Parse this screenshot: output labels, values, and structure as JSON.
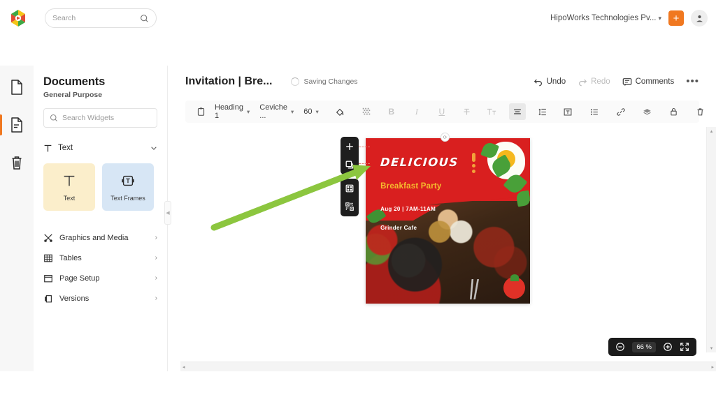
{
  "topbar": {
    "logo_icon": "app-logo-icon",
    "search": {
      "placeholder": "Search",
      "icon": "search-icon"
    },
    "org": {
      "name": "HipoWorks Technologies Pv...",
      "chevron": "chevron-down-icon"
    },
    "add_button": {
      "label": "+",
      "icon": "plus-icon",
      "color": "#f07820"
    },
    "account": {
      "icon": "user-avatar-icon"
    }
  },
  "rail": {
    "items": [
      {
        "name": "pages-icon",
        "active": false
      },
      {
        "name": "document-outline-icon",
        "active": true
      },
      {
        "name": "trash-icon",
        "active": false
      }
    ]
  },
  "panel": {
    "title": "Documents",
    "subtitle": "General Purpose",
    "search": {
      "placeholder": "Search Widgets",
      "icon": "search-icon"
    },
    "section": {
      "label": "Text",
      "icon": "text-t-icon",
      "chevron": "chevron-down-icon"
    },
    "tiles": [
      {
        "label": "Text",
        "icon": "text-t-icon",
        "color": "#fbeecb"
      },
      {
        "label": "Text Frames",
        "icon": "text-frame-icon",
        "color": "#d7e6f5"
      }
    ],
    "nav": [
      {
        "label": "Graphics and Media",
        "icon": "graphics-media-icon",
        "arrow": "chevron-right-icon"
      },
      {
        "label": "Tables",
        "icon": "table-grid-icon",
        "arrow": "chevron-right-icon"
      },
      {
        "label": "Page Setup",
        "icon": "page-setup-icon",
        "arrow": "chevron-right-icon"
      },
      {
        "label": "Versions",
        "icon": "versions-icon",
        "arrow": "chevron-right-icon"
      }
    ],
    "collapse": {
      "icon": "chevron-left-icon"
    }
  },
  "dochead": {
    "title": "Invitation | Bre...",
    "status": "Saving Changes",
    "status_icon": "spinner-icon",
    "undo": {
      "label": "Undo",
      "icon": "undo-arrow-icon"
    },
    "redo": {
      "label": "Redo",
      "icon": "redo-arrow-icon"
    },
    "comments": {
      "label": "Comments",
      "icon": "comment-bubble-icon"
    },
    "more": {
      "label": "•••",
      "icon": "more-horizontal-icon"
    }
  },
  "toolbar": {
    "clipboard": {
      "icon": "clipboard-paste-icon"
    },
    "style": {
      "value": "Heading 1",
      "chevron": "chevron-down-icon"
    },
    "font": {
      "value": "Ceviche ...",
      "chevron": "chevron-down-icon"
    },
    "size": {
      "value": "60",
      "chevron": "chevron-down-icon"
    },
    "fill": {
      "icon": "paint-bucket-icon"
    },
    "pattern": {
      "icon": "texture-grid-icon"
    },
    "bold": {
      "label": "B",
      "icon": "bold-icon"
    },
    "italic": {
      "label": "I",
      "icon": "italic-icon"
    },
    "underline": {
      "label": "U",
      "icon": "underline-icon"
    },
    "strikethrough": {
      "label": "T",
      "icon": "strikethrough-icon"
    },
    "clear_format": {
      "label": "Tt",
      "icon": "clear-formatting-icon"
    },
    "align": {
      "icon": "align-center-icon",
      "active": true
    },
    "line_spacing": {
      "icon": "line-spacing-icon"
    },
    "text_box": {
      "icon": "text-box-icon"
    },
    "list": {
      "icon": "bullet-list-icon"
    },
    "link": {
      "icon": "link-chain-icon"
    },
    "layers": {
      "icon": "layers-icon"
    },
    "lock": {
      "icon": "lock-icon"
    },
    "delete": {
      "icon": "trash-icon"
    }
  },
  "canvas": {
    "rotate_handle": {
      "icon": "rotate-handle-icon"
    },
    "element_tools": [
      {
        "icon": "plus-icon"
      },
      {
        "icon": "duplicate-icon"
      },
      {
        "icon": "grid-layout-icon"
      },
      {
        "icon": "qr-code-icon"
      }
    ],
    "annotation": {
      "icon": "green-arrow-annotation",
      "color": "#8cc63f"
    },
    "invitation": {
      "title": "DELICIOUS",
      "subtitle": "Breakfast Party",
      "line1": "Aug 20 | 7AM-11AM",
      "line2": "Grinder Cafe",
      "bg_color": "#d91f1f",
      "title_color": "#ffffff",
      "subtitle_color": "#f5bb2e"
    }
  },
  "zoom": {
    "out_icon": "zoom-out-icon",
    "value": "66 %",
    "in_icon": "zoom-in-icon",
    "fit_icon": "fit-screen-icon"
  },
  "scrollbars": {
    "v_up": "▴",
    "v_down": "▾",
    "h_left": "◂",
    "h_right": "▸"
  }
}
